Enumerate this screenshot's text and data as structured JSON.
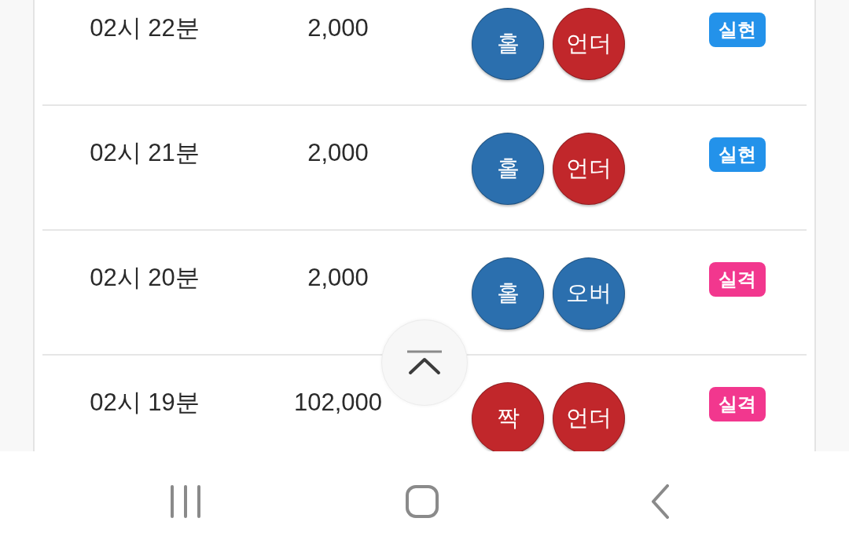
{
  "rows": [
    {
      "time": "02시 22분",
      "amount": "2,000",
      "picks": [
        {
          "label": "홀",
          "color": "#2b6fae"
        },
        {
          "label": "언더",
          "color": "#c1272b"
        }
      ],
      "result": {
        "label": "실현",
        "color": "#2392ea"
      }
    },
    {
      "time": "02시 21분",
      "amount": "2,000",
      "picks": [
        {
          "label": "홀",
          "color": "#2b6fae"
        },
        {
          "label": "언더",
          "color": "#c1272b"
        }
      ],
      "result": {
        "label": "실현",
        "color": "#2392ea"
      }
    },
    {
      "time": "02시 20분",
      "amount": "2,000",
      "picks": [
        {
          "label": "홀",
          "color": "#2b6fae"
        },
        {
          "label": "오버",
          "color": "#2b6fae"
        }
      ],
      "result": {
        "label": "실격",
        "color": "#f2378e"
      }
    },
    {
      "time": "02시 19분",
      "amount": "102,000",
      "picks": [
        {
          "label": "짝",
          "color": "#c1272b"
        },
        {
          "label": "언더",
          "color": "#c1272b"
        }
      ],
      "result": {
        "label": "실격",
        "color": "#f2378e"
      }
    }
  ]
}
